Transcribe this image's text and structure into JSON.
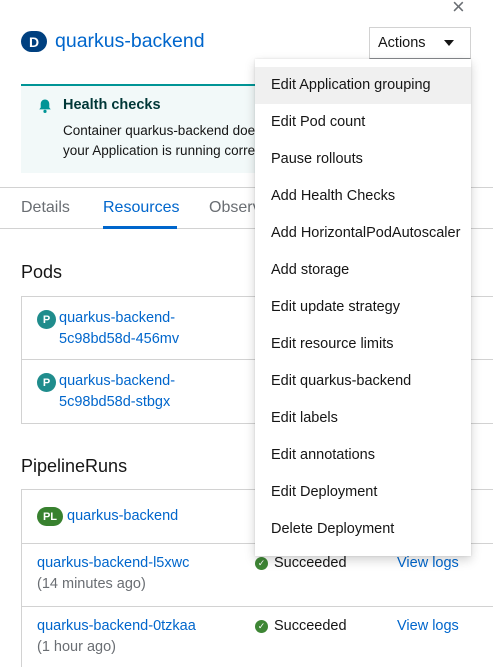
{
  "header": {
    "badge": "D",
    "title": "quarkus-backend",
    "close_icon": "×",
    "actions_label": "Actions"
  },
  "alert": {
    "icon": "bell-icon",
    "title": "Health checks",
    "body_line1": "Container quarkus-backend does",
    "body_line2": "your Application is running correc"
  },
  "tabs": [
    {
      "label": "Details"
    },
    {
      "label": "Resources"
    },
    {
      "label": "Observ"
    }
  ],
  "pods": {
    "heading": "Pods",
    "items": [
      {
        "badge": "P",
        "line1": "quarkus-backend-",
        "line2": "5c98bd58d-456mv"
      },
      {
        "badge": "P",
        "line1": "quarkus-backend-",
        "line2": "5c98bd58d-stbgx"
      }
    ]
  },
  "pipelineruns": {
    "heading": "PipelineRuns",
    "pipeline": {
      "badge": "PL",
      "name": "quarkus-backend"
    },
    "runs": [
      {
        "name": "quarkus-backend-l5xwc",
        "time": "(14 minutes ago)",
        "status": "Succeeded",
        "logs": "View logs"
      },
      {
        "name": "quarkus-backend-0tzkaa",
        "time": "(1 hour ago)",
        "status": "Succeeded",
        "logs": "View logs"
      }
    ]
  },
  "menu": {
    "items": [
      "Edit Application grouping",
      "Edit Pod count",
      "Pause rollouts",
      "Add Health Checks",
      "Add HorizontalPodAutoscaler",
      "Add storage",
      "Edit update strategy",
      "Edit resource limits",
      "Edit quarkus-backend",
      "Edit labels",
      "Edit annotations",
      "Edit Deployment",
      "Delete Deployment"
    ]
  },
  "colors": {
    "link": "#0066cc",
    "success": "#3e8635",
    "alert_bg": "#f2f9f9"
  }
}
